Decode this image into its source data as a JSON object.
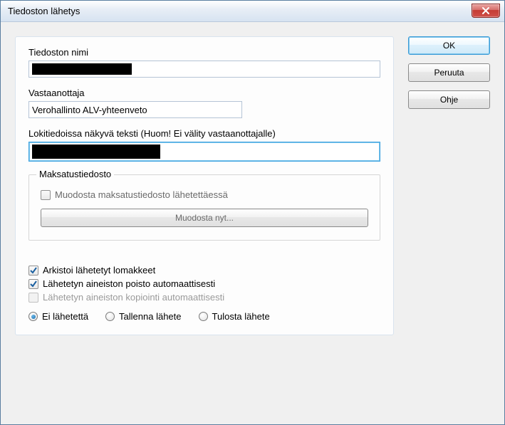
{
  "window": {
    "title": "Tiedoston lähetys"
  },
  "buttons": {
    "ok": "OK",
    "cancel": "Peruuta",
    "help": "Ohje"
  },
  "fields": {
    "filename_label": "Tiedoston nimi",
    "filename_value": "",
    "recipient_label": "Vastaanottaja",
    "recipient_value": "Verohallinto ALV-yhteenveto",
    "logtext_label": "Lokitiedoissa näkyvä teksti (Huom! Ei välity vastaanottajalle)",
    "logtext_value": ""
  },
  "payment_group": {
    "legend": "Maksatustiedosto",
    "create_on_send_label": "Muodosta maksatustiedosto lähetettäessä",
    "create_on_send_checked": false,
    "create_now_button": "Muodosta nyt..."
  },
  "options": {
    "archive_label": "Arkistoi lähetetyt lomakkeet",
    "archive_checked": true,
    "autodelete_label": "Lähetetyn aineiston poisto automaattisesti",
    "autodelete_checked": true,
    "autocopy_label": "Lähetetyn aineiston kopiointi automaattisesti",
    "autocopy_checked": false,
    "autocopy_disabled": true
  },
  "radios": {
    "selected": "none",
    "none_label": "Ei lähetettä",
    "save_label": "Tallenna lähete",
    "print_label": "Tulosta lähete"
  }
}
